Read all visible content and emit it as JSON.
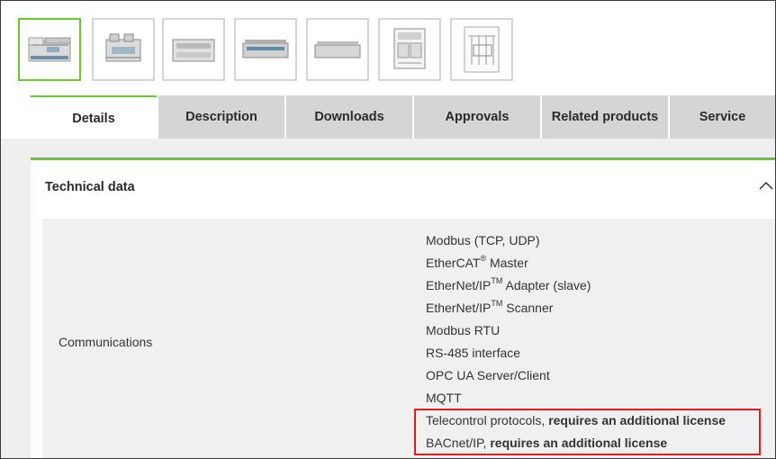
{
  "thumbnails": [
    {
      "name": "product-photo-front",
      "selected": true
    },
    {
      "name": "product-photo-angle",
      "selected": false
    },
    {
      "name": "product-photo-top",
      "selected": false
    },
    {
      "name": "product-photo-side",
      "selected": false
    },
    {
      "name": "product-photo-profile",
      "selected": false
    },
    {
      "name": "dimension-drawing",
      "selected": false
    },
    {
      "name": "circuit-diagram",
      "selected": false
    }
  ],
  "tabs": [
    {
      "label": "Details",
      "active": true
    },
    {
      "label": "Description",
      "active": false
    },
    {
      "label": "Downloads",
      "active": false
    },
    {
      "label": "Approvals",
      "active": false
    },
    {
      "label": "Related products",
      "active": false
    },
    {
      "label": "Service",
      "active": false
    }
  ],
  "section": {
    "title": "Technical data",
    "collapse_icon": "chevron-up-icon"
  },
  "communications": {
    "label": "Communications",
    "items": [
      {
        "text": "Modbus (TCP, UDP)"
      },
      {
        "text": "EtherCAT",
        "suffix_sup": "®",
        "after": " Master"
      },
      {
        "text": "EtherNet/IP",
        "suffix_sup": "TM",
        "after": " Adapter (slave)"
      },
      {
        "text": "EtherNet/IP",
        "suffix_sup": "TM",
        "after": " Scanner"
      },
      {
        "text": "Modbus RTU"
      },
      {
        "text": "RS-485 interface"
      },
      {
        "text": "OPC UA Server/Client"
      },
      {
        "text": "MQTT"
      },
      {
        "text": "Telecontrol protocols, ",
        "bold": "requires an additional license"
      },
      {
        "text": "BACnet/IP, ",
        "bold": "requires an additional license"
      }
    ]
  },
  "colors": {
    "accent": "#6ac72c",
    "tab_inactive": "#d5d5d5",
    "highlight_box": "#e01c1c"
  }
}
